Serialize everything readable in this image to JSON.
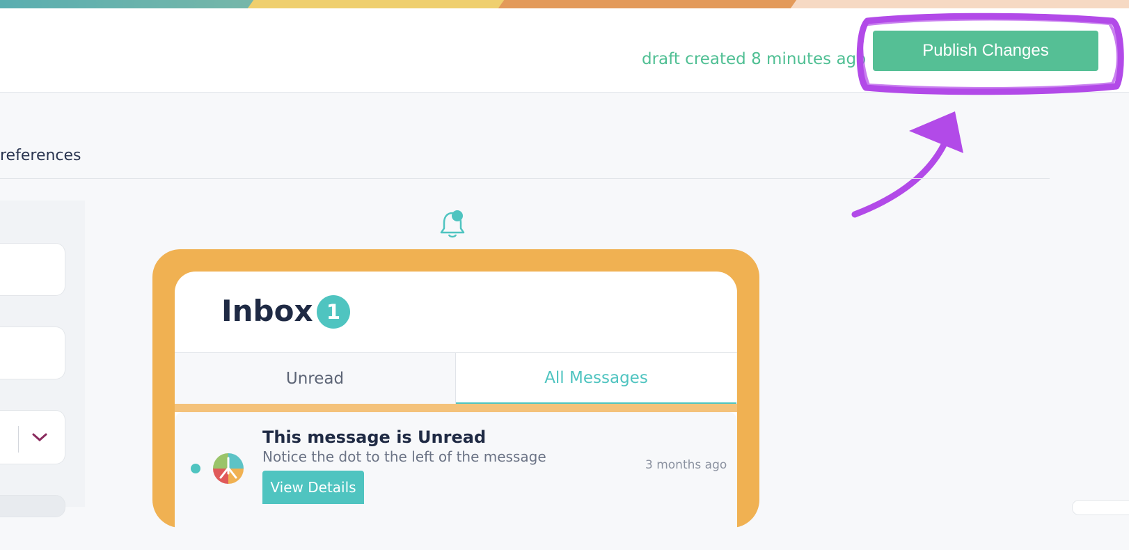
{
  "header": {
    "draft_status": "draft created 8 minutes ago",
    "publish_label": "Publish Changes"
  },
  "tabs": {
    "preferences_label": "references"
  },
  "inbox": {
    "title": "Inbox",
    "badge_count": "1",
    "tabs": [
      {
        "label": "Unread"
      },
      {
        "label": "All Messages"
      }
    ],
    "active_tab": "All Messages",
    "message": {
      "title": "This message is Unread",
      "subtitle": "Notice the dot to the left of the message",
      "time": "3 months ago",
      "button_label": "View Details"
    }
  },
  "colors": {
    "accent": "#55bf95",
    "teal": "#4fc4c0",
    "frame": "#f0b152",
    "annotation": "#b24ae8"
  },
  "icons": [
    "bell-icon",
    "chevron-down-icon",
    "app-logo"
  ]
}
